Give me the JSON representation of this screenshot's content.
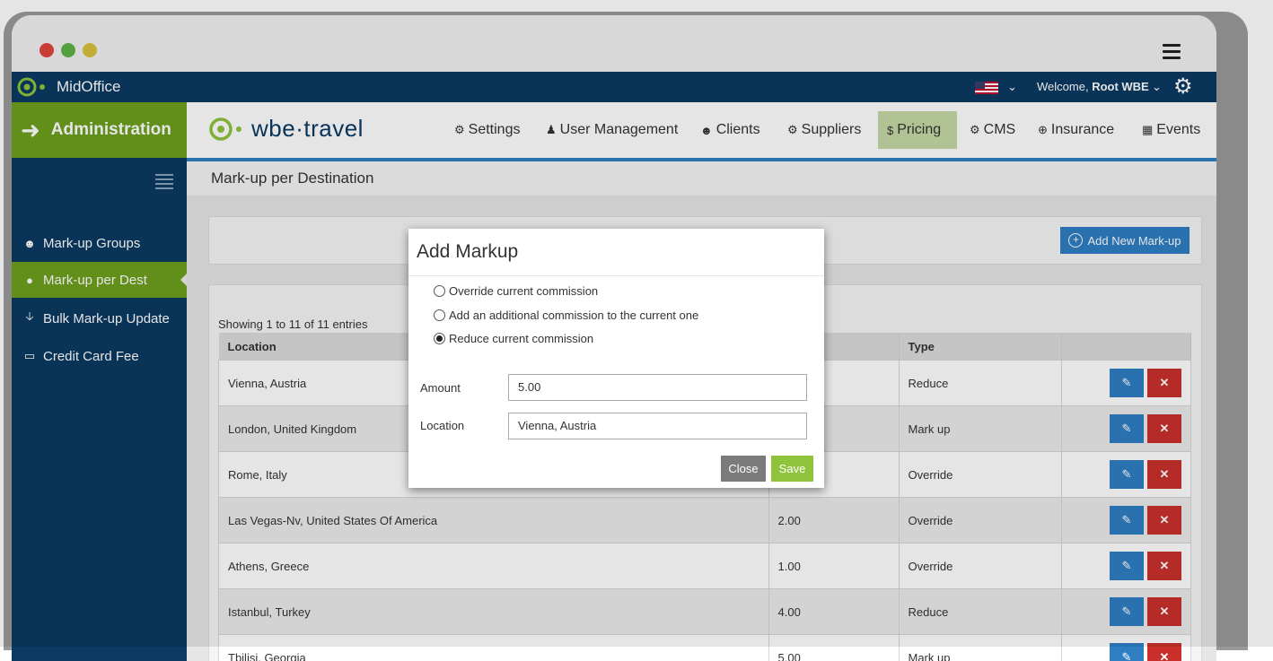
{
  "app": {
    "name": "MidOffice",
    "logo_text": "wbe·travel",
    "section": "Administration"
  },
  "topbar": {
    "welcome_prefix": "Welcome,",
    "user": "Root WBE"
  },
  "nav": [
    {
      "label": "Settings",
      "icon": "gear-icon"
    },
    {
      "label": "User Management",
      "icon": "user-icon"
    },
    {
      "label": "Clients",
      "icon": "users-icon"
    },
    {
      "label": "Suppliers",
      "icon": "gears-icon"
    },
    {
      "label": "Pricing",
      "icon": "dollar-icon",
      "active": true
    },
    {
      "label": "CMS",
      "icon": "gear-icon"
    },
    {
      "label": "Insurance",
      "icon": "plus-circle-icon"
    },
    {
      "label": "Events",
      "icon": "calendar-icon"
    }
  ],
  "sidebar": {
    "items": [
      {
        "label": "Mark-up Groups",
        "icon": "users-icon"
      },
      {
        "label": "Mark-up per Dest",
        "icon": "globe-icon",
        "active": true
      },
      {
        "label": "Bulk Mark-up Update",
        "icon": "arrow-down-icon"
      },
      {
        "label": "Credit Card Fee",
        "icon": "credit-card-icon"
      }
    ]
  },
  "page": {
    "title": "Mark-up per Destination",
    "add_button": "Add New Mark-up",
    "showing": "Showing 1 to 11 of 11 entries"
  },
  "table": {
    "headers": [
      "Location",
      "",
      "Type",
      ""
    ],
    "rows": [
      {
        "location": "Vienna, Austria",
        "amount": "",
        "type": "Reduce"
      },
      {
        "location": "London, United Kingdom",
        "amount": "",
        "type": "Mark up"
      },
      {
        "location": "Rome, Italy",
        "amount": "",
        "type": "Override"
      },
      {
        "location": "Las Vegas-Nv, United States Of America",
        "amount": "2.00",
        "type": "Override"
      },
      {
        "location": "Athens, Greece",
        "amount": "1.00",
        "type": "Override"
      },
      {
        "location": "Istanbul, Turkey",
        "amount": "4.00",
        "type": "Reduce"
      },
      {
        "location": "Tbilisi, Georgia",
        "amount": "5.00",
        "type": "Mark up"
      }
    ]
  },
  "modal": {
    "title": "Add Markup",
    "options": [
      {
        "label": "Override current commission",
        "checked": false
      },
      {
        "label": "Add an additional commission to the current one",
        "checked": false
      },
      {
        "label": "Reduce current commission",
        "checked": true
      }
    ],
    "amount_label": "Amount",
    "amount_value": "5.00",
    "location_label": "Location",
    "location_value": "Vienna, Austria",
    "close_label": "Close",
    "save_label": "Save"
  },
  "colors": {
    "navy": "#0b3a63",
    "green": "#6e9f1d",
    "blue": "#2f7ec4",
    "red": "#c9302c",
    "save_green": "#8ec33b"
  }
}
